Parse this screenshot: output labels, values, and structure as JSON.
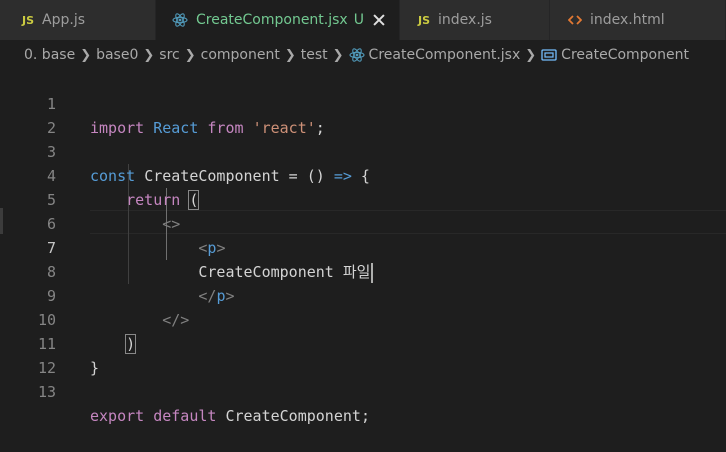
{
  "tabs": [
    {
      "icon": "JS",
      "label": "App.js",
      "active": false
    },
    {
      "icon": "react-icon",
      "label": "CreateComponent.jsx",
      "flag": "U",
      "active": true
    },
    {
      "icon": "JS",
      "label": "index.js",
      "active": false
    },
    {
      "icon": "html-icon",
      "label": "index.html",
      "active": false
    }
  ],
  "breadcrumb": [
    "0. base",
    "base0",
    "src",
    "component",
    "test",
    "CreateComponent.jsx",
    "CreateComponent"
  ],
  "editor": {
    "line_numbers": [
      "1",
      "2",
      "3",
      "4",
      "5",
      "6",
      "7",
      "8",
      "9",
      "10",
      "11",
      "12",
      "13"
    ],
    "lines": {
      "l1": {
        "import": "import",
        "react": "React",
        "from": "from",
        "str": "'react'",
        "semi": ";"
      },
      "l3": {
        "const": "const",
        "name": "CreateComponent",
        "rest": " = () ",
        "arrow": "=>",
        "brace": " {"
      },
      "l4": {
        "ret": "return",
        "paren": "("
      },
      "l5": {
        "frag": "<>"
      },
      "l6": {
        "open": "<",
        "tag": "p",
        "close": ">"
      },
      "l7": {
        "text": "CreateComponent 파일"
      },
      "l8": {
        "open": "</",
        "tag": "p",
        "close": ">"
      },
      "l9": {
        "frag": "</>"
      },
      "l10": {
        "paren": ")"
      },
      "l11": {
        "brace": "}"
      },
      "l13": {
        "export": "export",
        "default": "default",
        "name": "CreateComponent",
        "semi": ";"
      }
    }
  },
  "colors": {
    "keyword": "#c586c0",
    "blue": "#569cd6",
    "string": "#ce9178",
    "text": "#d4d4d4",
    "modified": "#73c991"
  }
}
